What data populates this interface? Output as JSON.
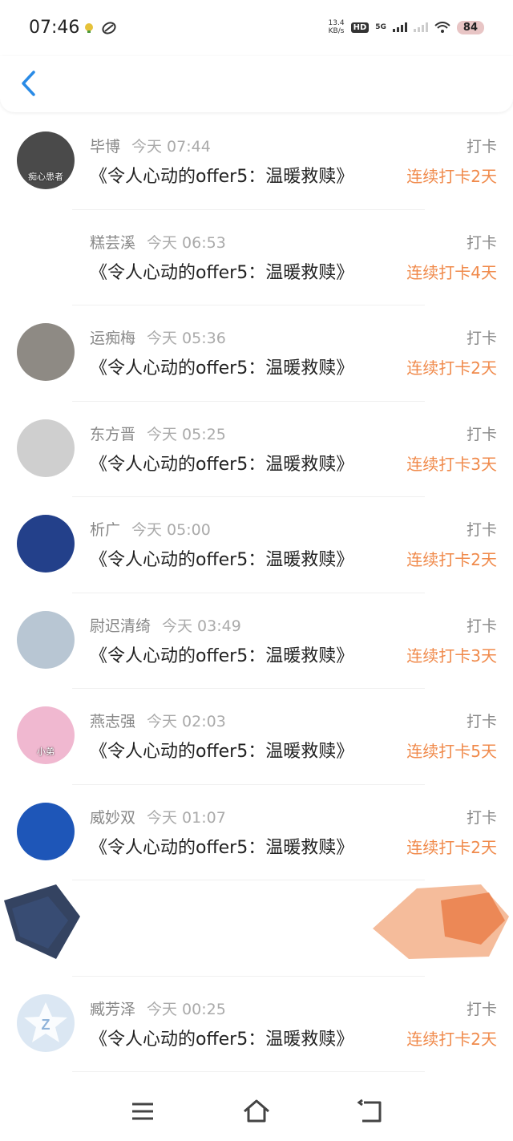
{
  "status_bar": {
    "time": "07:46",
    "net_speed_value": "13.4",
    "net_speed_unit": "KB/s",
    "hd": "HD",
    "network": "5G",
    "battery": "84"
  },
  "items": [
    {
      "name": "毕博",
      "time": "今天 07:44",
      "title": "《令人心动的offer5：温暖救赎》",
      "action": "打卡",
      "streak": "连续打卡2天",
      "avatar_color": "#4a4a4a",
      "avatar_text": "痴心患者"
    },
    {
      "name": "糕芸溪",
      "time": "今天 06:53",
      "title": "《令人心动的offer5：温暖救赎》",
      "action": "打卡",
      "streak": "连续打卡4天",
      "avatar_color": "#ffffff",
      "avatar_text": ""
    },
    {
      "name": "运痴梅",
      "time": "今天 05:36",
      "title": "《令人心动的offer5：温暖救赎》",
      "action": "打卡",
      "streak": "连续打卡2天",
      "avatar_color": "#8e8a84",
      "avatar_text": ""
    },
    {
      "name": "东方晋",
      "time": "今天 05:25",
      "title": "《令人心动的offer5：温暖救赎》",
      "action": "打卡",
      "streak": "连续打卡3天",
      "avatar_color": "#cfcfcf",
      "avatar_text": ""
    },
    {
      "name": "析广",
      "time": "今天 05:00",
      "title": "《令人心动的offer5：温暖救赎》",
      "action": "打卡",
      "streak": "连续打卡2天",
      "avatar_color": "#23408a",
      "avatar_text": ""
    },
    {
      "name": "尉迟清绮",
      "time": "今天 03:49",
      "title": "《令人心动的offer5：温暖救赎》",
      "action": "打卡",
      "streak": "连续打卡3天",
      "avatar_color": "#b8c6d3",
      "avatar_text": ""
    },
    {
      "name": "燕志强",
      "time": "今天 02:03",
      "title": "《令人心动的offer5：温暖救赎》",
      "action": "打卡",
      "streak": "连续打卡5天",
      "avatar_color": "#f0b8d0",
      "avatar_text": "小弟"
    },
    {
      "name": "威妙双",
      "time": "今天 01:07",
      "title": "《令人心动的offer5：温暖救赎》",
      "action": "打卡",
      "streak": "连续打卡2天",
      "avatar_color": "#1e56b8",
      "avatar_text": ""
    }
  ],
  "last_item": {
    "name": "臧芳泽",
    "time": "今天 00:25",
    "title": "《令人心动的offer5：温暖救赎》",
    "action": "打卡",
    "streak": "连续打卡2天",
    "avatar_color": "#dbe7f3"
  },
  "colors": {
    "accent_orange": "#f08a4b",
    "back_blue": "#2a8be6"
  }
}
